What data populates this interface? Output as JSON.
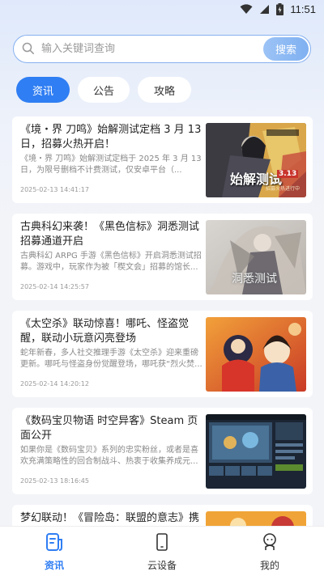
{
  "status_bar": {
    "time": "11:51"
  },
  "search": {
    "placeholder": "输入关键词查询",
    "button_label": "搜索"
  },
  "tabs": [
    {
      "label": "资讯",
      "active": true
    },
    {
      "label": "公告",
      "active": false
    },
    {
      "label": "攻略",
      "active": false
    }
  ],
  "articles": [
    {
      "title": "《境・界 刀鸣》始解测试定档 3 月 13 日，招募火热开启！",
      "summary": "《境・界 刀鸣》始解测试定档于 2025 年 3 月 13 日，为限号删档不计费测试，仅安卓平台（...",
      "date": "2025-02-13 14:41:17",
      "thumb_text": "始解测试",
      "thumb_badge": "3.13",
      "thumb_sub": "招募火热进行中"
    },
    {
      "title": "古典科幻来袭！《黑色信标》洞悉测试招募通道开启",
      "summary": "古典科幻 ARPG 手游《黑色信标》开启洞悉测试招募。游戏中，玩家作为被「楔文会」招募的馆长...",
      "date": "2025-02-14 14:25:57",
      "thumb_text": "洞悉测试"
    },
    {
      "title": "《太空杀》联动惊喜！哪吒、怪盗觉醒，联动小玩意闪亮登场",
      "summary": "蛇年新春，多人社交推理手游《太空杀》迎来重磅更新。哪吒与怪盗身份觉醒登场，哪吒获“烈火焚...",
      "date": "2025-02-14 14:20:12"
    },
    {
      "title": "《数码宝贝物语 时空异客》Steam 页面公开",
      "summary": "如果你是《数码宝贝》系列的忠实粉丝，或者是喜欢充满策略性的回合制战斗、热衷于收集养成元...",
      "date": "2025-02-13 18:16:45"
    },
    {
      "title": "梦幻联动！《冒险岛：联盟的意志》携手《...",
      "summary": "",
      "date": ""
    }
  ],
  "bottom_nav": [
    {
      "label": "资讯",
      "icon": "news-icon",
      "active": true
    },
    {
      "label": "云设备",
      "icon": "phone-device-icon",
      "active": false
    },
    {
      "label": "我的",
      "icon": "profile-icon",
      "active": false
    }
  ],
  "colors": {
    "accent": "#2f7ef3",
    "search_border": "#86b0ef",
    "background": "#f3f4f8"
  }
}
